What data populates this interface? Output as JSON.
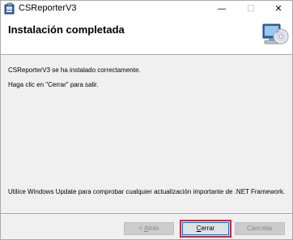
{
  "window": {
    "title": "CSReporterV3",
    "app_icon": "installer-app-icon",
    "controls": {
      "minimize_icon": "minimize-icon",
      "maximize_icon": "maximize-icon",
      "close_icon": "close-icon"
    }
  },
  "banner": {
    "heading": "Instalación completada",
    "icon": "computer-disc-icon"
  },
  "body": {
    "line1": "CSReporterV3 se ha instalado correctamente.",
    "line2": "Haga clic en \"Cerrar\" para salir.",
    "line3": "Utilice Windows Update para comprobar cualquier actualización importante de .NET Framework."
  },
  "buttons": {
    "back": {
      "prefix": "< ",
      "mnemonic": "A",
      "rest": "trás",
      "enabled": false
    },
    "close": {
      "mnemonic": "C",
      "rest": "errar",
      "enabled": true,
      "highlighted": true,
      "highlight_color": "#c8283c"
    },
    "cancel": {
      "label": "Cancelar",
      "enabled": false
    }
  }
}
